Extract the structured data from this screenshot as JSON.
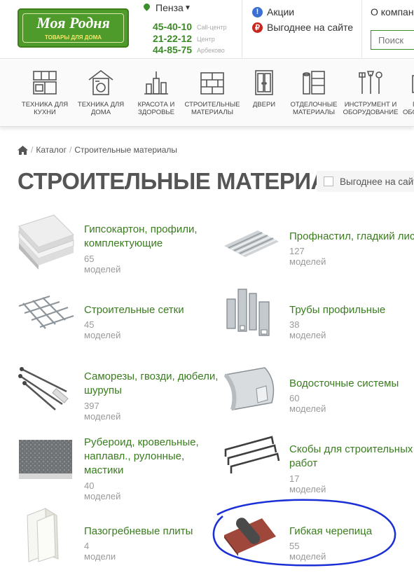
{
  "header": {
    "logo_name": "Моя Родня",
    "logo_tagline": "ТОВАРЫ ДЛЯ ДОМА",
    "city": "Пенза",
    "phones": [
      {
        "number": "45-40-10",
        "label": "Call-центр"
      },
      {
        "number": "21-22-12",
        "label": "Центр"
      },
      {
        "number": "44-85-75",
        "label": "Арбеково"
      }
    ],
    "promo_link": "Акции",
    "deal_link": "Выгоднее на сайте",
    "about_link": "О компании",
    "search_placeholder": "Поиск"
  },
  "nav": {
    "items": [
      {
        "label_l1": "ТЕХНИКА ДЛЯ",
        "label_l2": "КУХНИ"
      },
      {
        "label_l1": "ТЕХНИКА ДЛЯ",
        "label_l2": "ДОМА"
      },
      {
        "label_l1": "КРАСОТА И",
        "label_l2": "ЗДОРОВЬЕ"
      },
      {
        "label_l1": "СТРОИТЕЛЬНЫЕ",
        "label_l2": "МАТЕРИАЛЫ"
      },
      {
        "label_l1": "ДВЕРИ",
        "label_l2": ""
      },
      {
        "label_l1": "ОТДЕЛОЧНЫЕ",
        "label_l2": "МАТЕРИАЛЫ"
      },
      {
        "label_l1": "ИНСТРУМЕНТ И",
        "label_l2": "ОБОРУДОВАНИЕ"
      },
      {
        "label_l1": "П",
        "label_l2": "ОБОРУ"
      }
    ]
  },
  "breadcrumb": {
    "catalog": "Каталог",
    "current": "Строительные материалы"
  },
  "page_title": "СТРОИТЕЛЬНЫЕ МАТЕРИАЛЫ",
  "filter_label": "Выгоднее на сайте",
  "categories": [
    {
      "name_l1": "Гипсокартон, профили,",
      "name_l2": "комплектующие",
      "name_l3": "",
      "count": "65 моделей"
    },
    {
      "name_l1": "Профнастил, гладкий лист",
      "name_l2": "",
      "name_l3": "",
      "count": "127 моделей"
    },
    {
      "name_l1": "Строительные сетки",
      "name_l2": "",
      "name_l3": "",
      "count": "45 моделей"
    },
    {
      "name_l1": "Трубы профильные",
      "name_l2": "",
      "name_l3": "",
      "count": "38 моделей"
    },
    {
      "name_l1": "Саморезы, гвозди, дюбели,",
      "name_l2": "шурупы",
      "name_l3": "",
      "count": "397 моделей"
    },
    {
      "name_l1": "Водосточные системы",
      "name_l2": "",
      "name_l3": "",
      "count": "60 моделей"
    },
    {
      "name_l1": "Рубероид, кровельные,",
      "name_l2": "наплавл., рулонные,",
      "name_l3": "мастики",
      "count": "40 моделей"
    },
    {
      "name_l1": "Скобы для строительных",
      "name_l2": "работ",
      "name_l3": "",
      "count": "17 моделей"
    },
    {
      "name_l1": "Пазогребневые плиты",
      "name_l2": "",
      "name_l3": "",
      "count": "4 модели"
    },
    {
      "name_l1": "Гибкая черепица",
      "name_l2": "",
      "name_l3": "",
      "count": "55 моделей"
    }
  ],
  "colors": {
    "brand_green": "#3a8a25",
    "link_green": "#3a7d1f",
    "annotation_blue": "#1b2fd6"
  }
}
